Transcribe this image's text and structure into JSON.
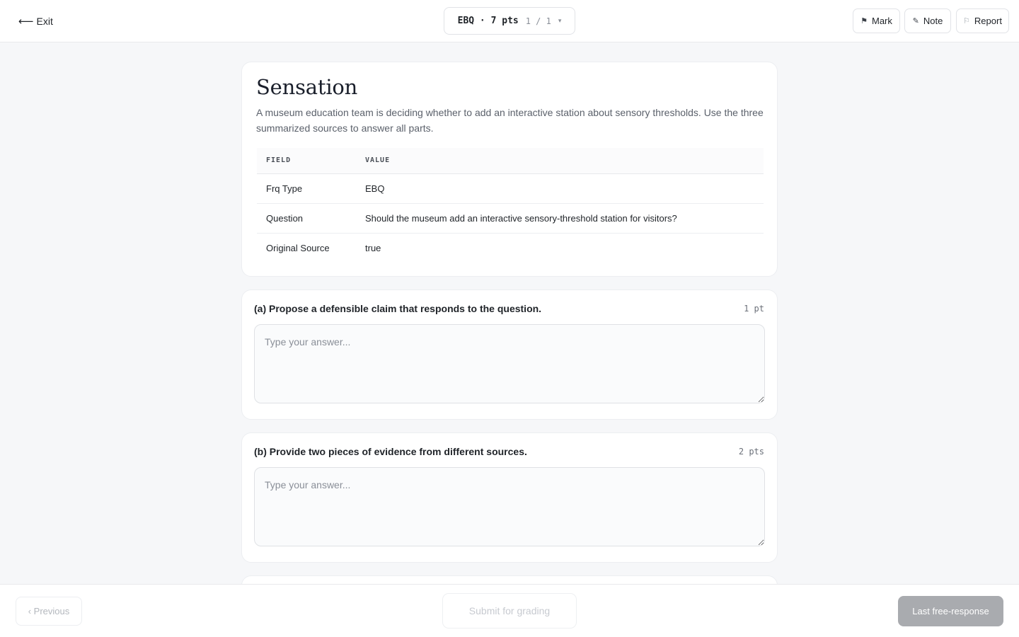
{
  "header": {
    "exit_label": "Exit",
    "exit_icon": "arrow-left-icon",
    "question_label": "EBQ · 7 pts",
    "question_count": "1 / 1",
    "mark_label": "Mark",
    "note_label": "Note",
    "report_label": "Report"
  },
  "intro": {
    "title": "Sensation",
    "description": "A museum education team is deciding whether to add an interactive station about sensory thresholds. Use the three summarized sources to answer all parts.",
    "table": {
      "headers": [
        "FIELD",
        "VALUE"
      ],
      "rows": [
        {
          "field": "Frq Type",
          "value": "EBQ"
        },
        {
          "field": "Question",
          "value": "Should the museum add an interactive sensory-threshold station for visitors?"
        },
        {
          "field": "Original Source",
          "value": "true"
        }
      ]
    }
  },
  "parts": [
    {
      "title": "(a) Propose a defensible claim that responds to the question.",
      "points": "1 pt",
      "placeholder": "Type your answer..."
    },
    {
      "title": "(b) Provide two pieces of evidence from different sources.",
      "points": "2 pts",
      "placeholder": "Type your answer..."
    }
  ],
  "footer": {
    "previous_label": "‹ Previous",
    "submit_label": "Submit for grading",
    "last_label": "Last free-response"
  },
  "colors": {
    "page_bg": "#f6f7f9",
    "card_bg": "#ffffff",
    "disabled_primary": "#a9abaf"
  }
}
